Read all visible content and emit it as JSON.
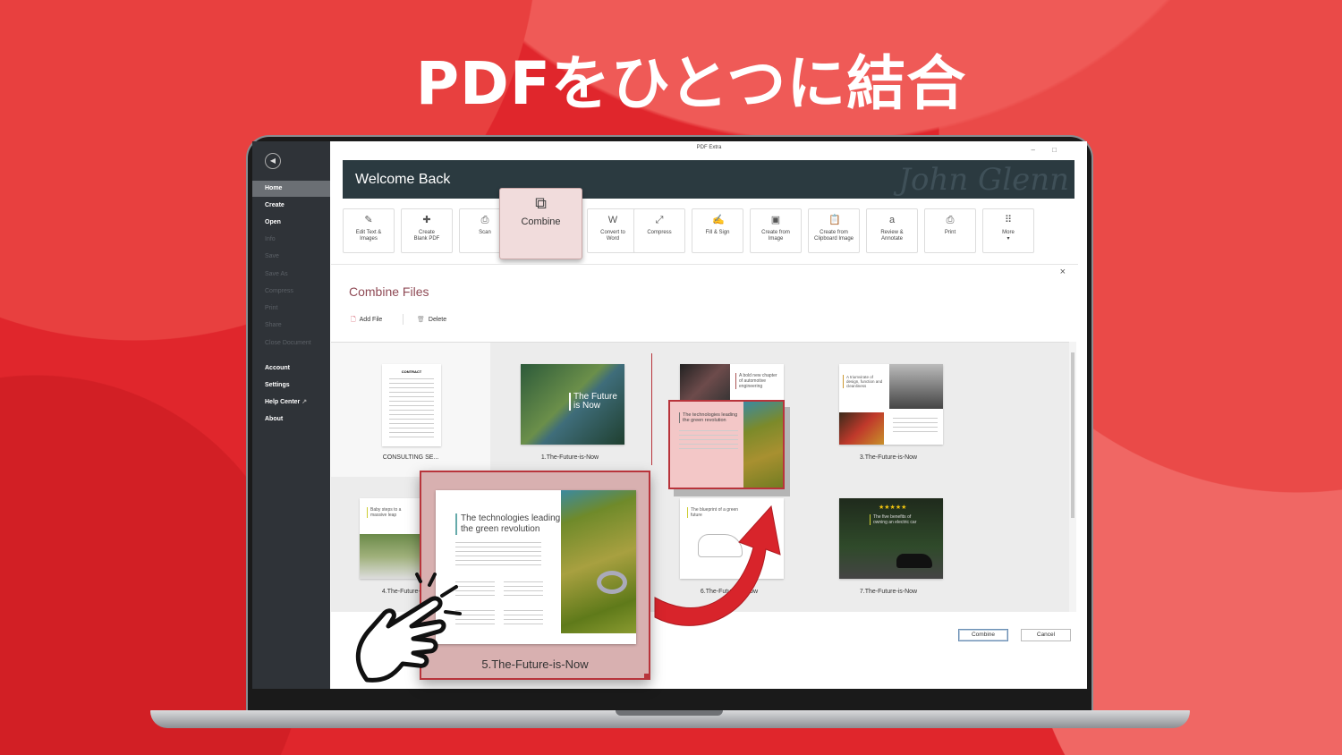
{
  "headline": "PDFをひとつに結合",
  "window": {
    "title": "PDF Extra",
    "minimize": "–",
    "maximize": "□"
  },
  "sidebar": {
    "items": [
      {
        "label": "Home",
        "state": "active"
      },
      {
        "label": "Create",
        "state": "enabled"
      },
      {
        "label": "Open",
        "state": "enabled"
      },
      {
        "label": "Info",
        "state": "disabled"
      },
      {
        "label": "Save",
        "state": "disabled"
      },
      {
        "label": "Save As",
        "state": "disabled"
      },
      {
        "label": "Compress",
        "state": "disabled"
      },
      {
        "label": "Print",
        "state": "disabled"
      },
      {
        "label": "Share",
        "state": "disabled"
      },
      {
        "label": "Close Document",
        "state": "disabled"
      },
      {
        "label": "Account",
        "state": "enabled"
      },
      {
        "label": "Settings",
        "state": "enabled"
      },
      {
        "label": "Help Center",
        "state": "enabled"
      },
      {
        "label": "About",
        "state": "enabled"
      }
    ],
    "help_ext_icon": "↗"
  },
  "banner": {
    "title": "Welcome Back",
    "signature": "John Glenn"
  },
  "toolbar": {
    "tiles": [
      {
        "label1": "Edit Text &",
        "label2": "Images",
        "icon": "✎"
      },
      {
        "label1": "Create",
        "label2": "Blank PDF",
        "icon": "✚"
      },
      {
        "label1": "Scan",
        "label2": "",
        "icon": "⎙"
      },
      {
        "label1": "Convert to",
        "label2": "Word",
        "icon": "W"
      },
      {
        "label1": "Compress",
        "label2": "",
        "icon": "⤢"
      },
      {
        "label1": "Fill & Sign",
        "label2": "",
        "icon": "✍"
      },
      {
        "label1": "Create from",
        "label2": "Image",
        "icon": "▣"
      },
      {
        "label1": "Create from",
        "label2": "Clipboard Image",
        "icon": "📋"
      },
      {
        "label1": "Review &",
        "label2": "Annotate",
        "icon": "a"
      },
      {
        "label1": "Print",
        "label2": "",
        "icon": "⎙"
      },
      {
        "label1": "More",
        "label2": "▾",
        "icon": "⠿"
      }
    ],
    "combine": {
      "label": "Combine",
      "icon": "⧉"
    }
  },
  "combine_panel": {
    "title": "Combine Files",
    "close": "×",
    "add_file": "Add File",
    "delete": "Delete",
    "files": [
      {
        "name": "CONSULTING SE...",
        "doc_heading": "CONTRACT"
      },
      {
        "name": "1.The-Future-is-Now",
        "doc_heading": "The Future is Now"
      },
      {
        "name": "",
        "doc_heading": "A bold new chapter of automotive engineering"
      },
      {
        "name": "3.The-Future-is-Now",
        "doc_heading": "A triumvirate of design, function and cleanliness"
      },
      {
        "name": "4.The-Future-is-Now",
        "doc_heading": "Baby steps to a massive leap"
      },
      {
        "name": "6.The-Future-is-Now",
        "doc_heading": "The blueprint of a green future"
      },
      {
        "name": "7.The-Future-is-Now",
        "doc_heading": "The five benefits of owning an electric car"
      }
    ],
    "combine_button": "Combine",
    "cancel_button": "Cancel"
  },
  "dragging": {
    "name": "5.The-Future-is-Now",
    "doc_heading": "The technologies leading the green revolution",
    "rating": "★★★★★"
  },
  "colors": {
    "background": "#e0262c",
    "accent": "#b8343b",
    "banner": "#2b3a40",
    "sidebar": "#2f3338"
  }
}
